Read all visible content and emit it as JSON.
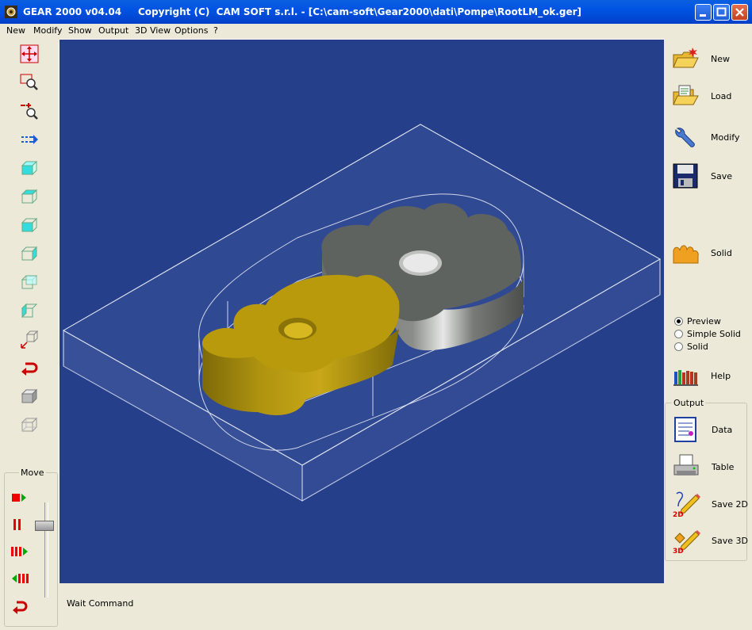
{
  "window": {
    "title": "GEAR 2000 v04.04     Copyright (C)  CAM SOFT s.r.l. - [C:\\cam-soft\\Gear2000\\dati\\Pompe\\RootLM_ok.ger]"
  },
  "menu": [
    "New",
    "Modify",
    "Show",
    "Output",
    "3D View",
    "Options",
    "?"
  ],
  "left_tools": [
    "move-view-icon",
    "zoom-window-icon",
    "zoom-in-out-icon",
    "pan-icon",
    "view-top-icon",
    "view-front-icon",
    "view-side-icon",
    "view-iso-icon",
    "view-back-icon",
    "view-left-icon",
    "view-rotate-icon",
    "undo-view-icon",
    "solid-cube-icon",
    "wire-cube-icon"
  ],
  "move": {
    "label": "Move",
    "speed_fraction": 0.23
  },
  "viewport": {
    "background": "#253f8b",
    "gear_gold": "#b89a0c",
    "gear_grey": "#5f6360"
  },
  "status": {
    "text": "Wait Command"
  },
  "right_buttons": [
    {
      "label": "New",
      "icon": "new-folder-icon"
    },
    {
      "label": "Load",
      "icon": "load-folder-icon"
    },
    {
      "label": "Modify",
      "icon": "wrench-icon"
    },
    {
      "label": "Save",
      "icon": "floppy-disk-icon"
    },
    {
      "label": "Solid",
      "icon": "solid-gear-icon"
    }
  ],
  "display_mode": {
    "options": [
      "Preview",
      "Simple Solid",
      "Solid"
    ],
    "selected": "Preview"
  },
  "help": {
    "label": "Help"
  },
  "output": {
    "label": "Output",
    "buttons": [
      {
        "label": "Data",
        "icon": "data-sheet-icon"
      },
      {
        "label": "Table",
        "icon": "printer-icon"
      },
      {
        "label": "Save 2D",
        "icon": "save-2d-icon",
        "badge": "2D"
      },
      {
        "label": "Save 3D",
        "icon": "save-3d-icon",
        "badge": "3D"
      }
    ]
  }
}
